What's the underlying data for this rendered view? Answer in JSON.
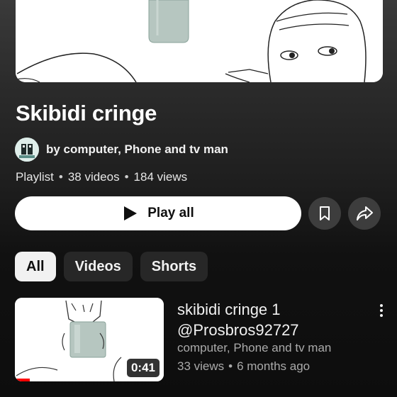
{
  "playlist": {
    "title": "Skibidi cringe",
    "owner": "by computer, Phone and tv man",
    "type": "Playlist",
    "video_count": "38 videos",
    "views": "184 views"
  },
  "actions": {
    "play_all_label": "Play all",
    "save_icon": "bookmark-icon",
    "share_icon": "share-icon"
  },
  "filters": [
    {
      "label": "All",
      "selected": true
    },
    {
      "label": "Videos",
      "selected": false
    },
    {
      "label": "Shorts",
      "selected": false
    }
  ],
  "videos": [
    {
      "title": "skibidi cringe 1 @Prosbros92727",
      "channel": "computer, Phone and tv man",
      "views": "33 views",
      "age": "6 months ago",
      "duration": "0:41",
      "watched_fraction": 0.1
    }
  ],
  "colors": {
    "background": "#0f0f0f",
    "accent_progress": "#ff0000",
    "chip_active": "#f1f1f1",
    "chip_inactive": "#272727"
  }
}
